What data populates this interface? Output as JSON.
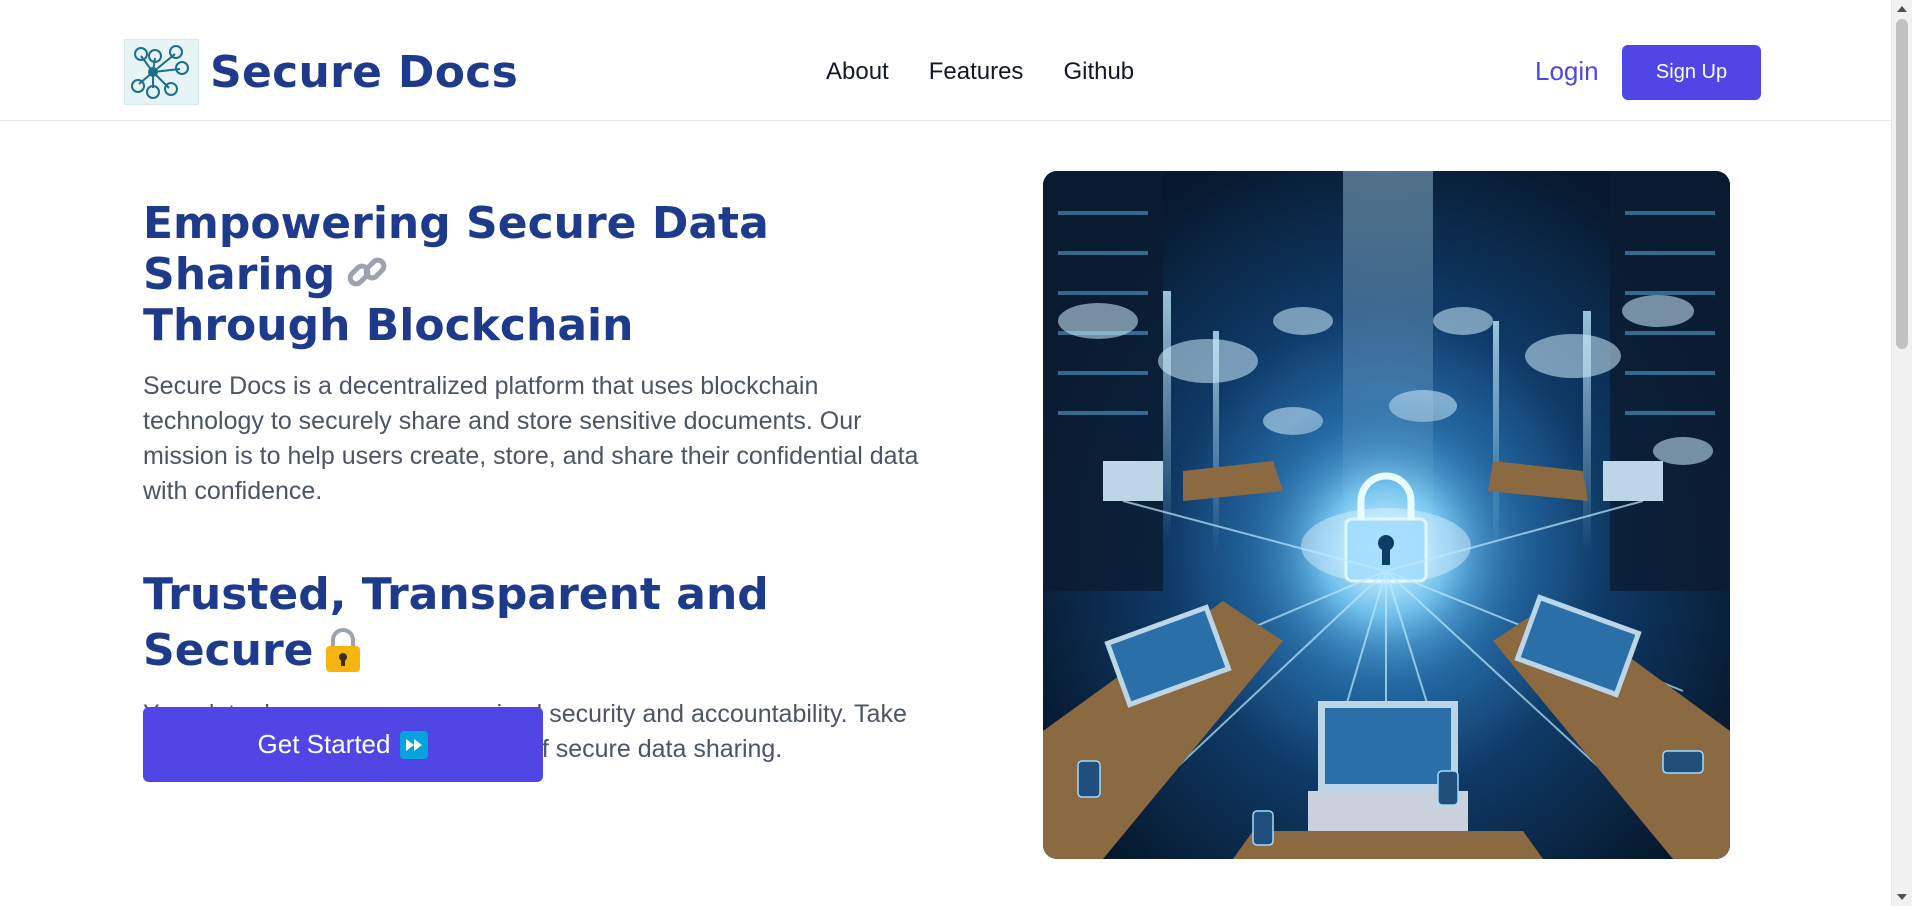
{
  "header": {
    "brand_name": "Secure Docs",
    "nav": [
      {
        "label": "About"
      },
      {
        "label": "Features"
      },
      {
        "label": "Github"
      }
    ],
    "login_label": "Login",
    "signup_label": "Sign Up"
  },
  "hero": {
    "heading_line1": "Empowering Secure Data Sharing",
    "heading_line2": "Through Blockchain",
    "description": "Secure Docs is a decentralized platform that uses blockchain technology to securely share and store sensitive documents. Our mission is to help users create, store, and share their confidential data with confidence.",
    "subheading": "Trusted, Transparent and Secure",
    "subdescription": "Your data deserves uncompromised security and accountability. Take control of your data with the future of secure data sharing.",
    "cta_label": "Get Started"
  },
  "icons": {
    "logo": "network-people-icon",
    "heading_emoji": "link-icon",
    "subheading_emoji": "lock-icon",
    "cta_emoji": "fast-forward-icon"
  },
  "colors": {
    "brand": "#1e3a8a",
    "accent": "#4f46e5",
    "text_muted": "#4b5563"
  }
}
